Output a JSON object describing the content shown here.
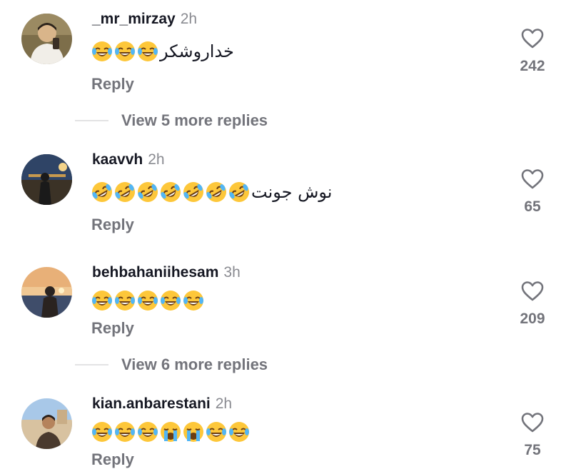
{
  "comments": [
    {
      "username": "_mr_mirzay",
      "time": "2h",
      "text": "خداروشکر",
      "emojis": [
        "laughing-tears",
        "laughing-tears",
        "laughing-tears"
      ],
      "reply_label": "Reply",
      "likes": "242",
      "avatar_colors": [
        "#7d6e4a",
        "#d9c7a4",
        "#3a2f25"
      ]
    },
    {
      "username": "kaavvh",
      "time": "2h",
      "text": "نوش جونت",
      "emojis": [
        "rofl",
        "rofl",
        "rofl",
        "rofl",
        "rofl",
        "rofl",
        "rofl"
      ],
      "reply_label": "Reply",
      "likes": "65",
      "avatar_colors": [
        "#23344f",
        "#c89a4e",
        "#1a1a1a"
      ]
    },
    {
      "username": "behbahaniihesam",
      "time": "3h",
      "text": "",
      "emojis": [
        "laughing-tears",
        "laughing-tears",
        "laughing-tears",
        "laughing-tears",
        "laughing-tears"
      ],
      "reply_label": "Reply",
      "likes": "209",
      "avatar_colors": [
        "#e8b078",
        "#3f4d6a",
        "#2a2320"
      ]
    },
    {
      "username": "kian.anbarestani",
      "time": "2h",
      "text": "",
      "emojis": [
        "laughing-tears",
        "laughing-tears",
        "laughing-tears",
        "loudly-crying",
        "loudly-crying",
        "laughing-tears",
        "laughing-tears"
      ],
      "reply_label": "Reply",
      "likes": "75",
      "avatar_colors": [
        "#a8c8e8",
        "#d8c2a0",
        "#4a3a2e"
      ]
    }
  ],
  "view_more": [
    {
      "label": "View 5 more replies"
    },
    {
      "label": "View 6 more replies"
    }
  ],
  "icons": {
    "like": "heart-outline-icon"
  },
  "colors": {
    "text_primary": "#161823",
    "text_secondary": "#73747b",
    "timestamp": "#8a8b91"
  }
}
